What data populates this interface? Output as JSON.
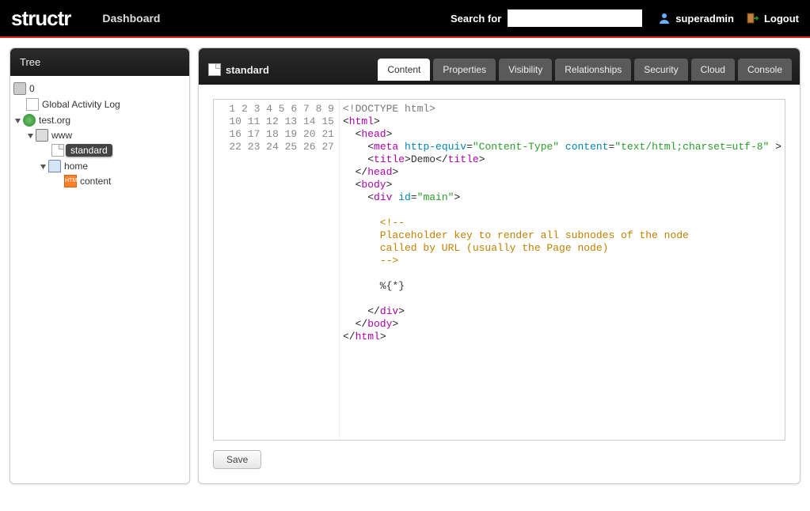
{
  "header": {
    "logo_text": "structr",
    "dashboard_label": "Dashboard",
    "search_label": "Search for",
    "search_value": "",
    "username": "superadmin",
    "logout_label": "Logout"
  },
  "sidebar": {
    "title": "Tree",
    "nodes": {
      "root_label": "0",
      "log_label": "Global Activity Log",
      "domain_label": "test.org",
      "www_label": "www",
      "standard_label": "standard",
      "home_label": "home",
      "content_label": "content"
    }
  },
  "content": {
    "current_item": "standard",
    "tabs": [
      {
        "label": "Content",
        "active": true
      },
      {
        "label": "Properties",
        "active": false
      },
      {
        "label": "Visibility",
        "active": false
      },
      {
        "label": "Relationships",
        "active": false
      },
      {
        "label": "Security",
        "active": false
      },
      {
        "label": "Cloud",
        "active": false
      },
      {
        "label": "Console",
        "active": false
      }
    ],
    "save_label": "Save",
    "code": {
      "line_count": 27,
      "lines": [
        {
          "n": 1,
          "t": "doctype",
          "txt": "<!DOCTYPE html>"
        },
        {
          "n": 2,
          "t": "tagopen",
          "ind": "",
          "tag": "html"
        },
        {
          "n": 3,
          "t": "tagopen",
          "ind": "  ",
          "tag": "head"
        },
        {
          "n": 4,
          "t": "tagattrs",
          "ind": "    ",
          "tag": "meta",
          "attrs": [
            [
              "http-equiv",
              "Content-Type"
            ],
            [
              "content",
              "text/html;charset=utf-8"
            ]
          ],
          "selfspace": true
        },
        {
          "n": 5,
          "t": "tagfull",
          "ind": "    ",
          "tag": "title",
          "body": "Demo"
        },
        {
          "n": 6,
          "t": "tagclose",
          "ind": "  ",
          "tag": "head"
        },
        {
          "n": 7,
          "t": "tagopen",
          "ind": "  ",
          "tag": "body"
        },
        {
          "n": 8,
          "t": "tagattrs",
          "ind": "    ",
          "tag": "div",
          "attrs": [
            [
              "id",
              "main"
            ]
          ]
        },
        {
          "n": 9,
          "t": "blank"
        },
        {
          "n": 10,
          "t": "comment",
          "ind": "      ",
          "txt": "<!--"
        },
        {
          "n": 11,
          "t": "comment",
          "ind": "      ",
          "txt": "Placeholder key to render all subnodes of the node"
        },
        {
          "n": 12,
          "t": "comment",
          "ind": "      ",
          "txt": "called by URL (usually the Page node)"
        },
        {
          "n": 13,
          "t": "comment",
          "ind": "      ",
          "txt": "-->"
        },
        {
          "n": 14,
          "t": "blank"
        },
        {
          "n": 15,
          "t": "plain",
          "ind": "      ",
          "txt": "%{*}"
        },
        {
          "n": 16,
          "t": "blank"
        },
        {
          "n": 17,
          "t": "tagclose",
          "ind": "    ",
          "tag": "div"
        },
        {
          "n": 18,
          "t": "tagclose",
          "ind": "  ",
          "tag": "body"
        },
        {
          "n": 19,
          "t": "tagclose",
          "ind": "",
          "tag": "html"
        },
        {
          "n": 20,
          "t": "blank"
        },
        {
          "n": 21,
          "t": "blank"
        },
        {
          "n": 22,
          "t": "blank"
        },
        {
          "n": 23,
          "t": "blank"
        },
        {
          "n": 24,
          "t": "blank"
        },
        {
          "n": 25,
          "t": "blank"
        },
        {
          "n": 26,
          "t": "blank"
        },
        {
          "n": 27,
          "t": "blank"
        }
      ]
    }
  }
}
